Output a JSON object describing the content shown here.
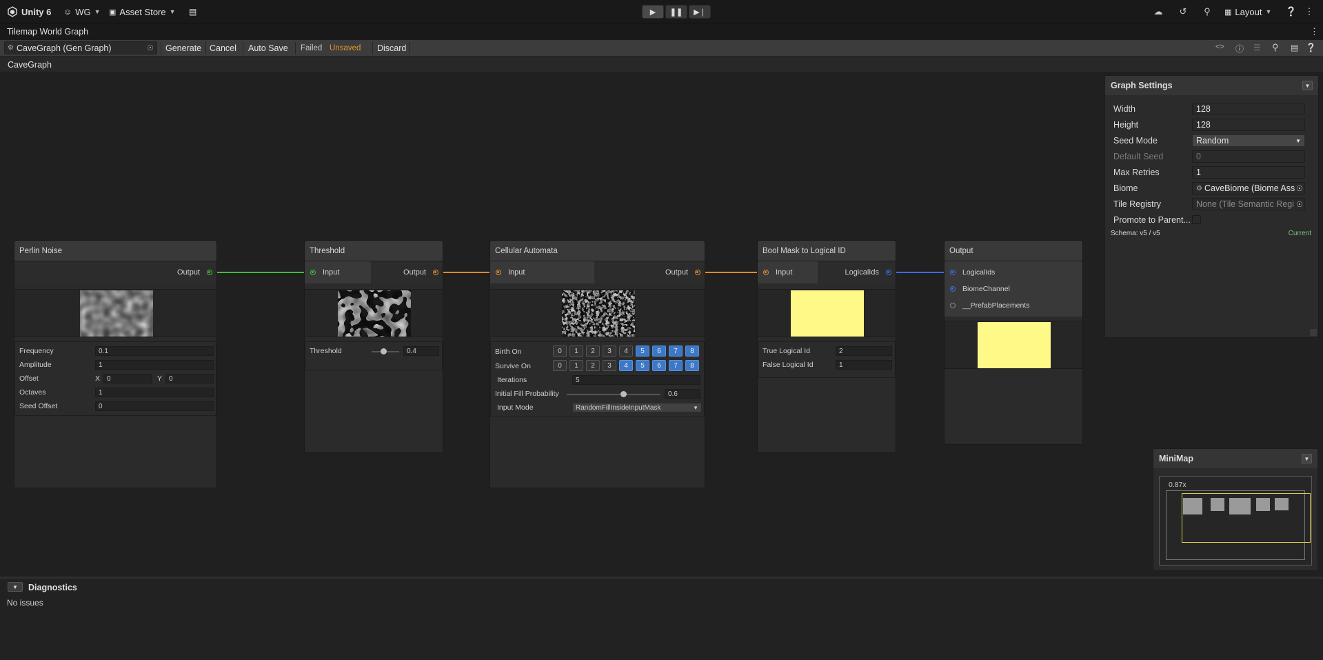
{
  "appbar": {
    "product": "Unity 6",
    "account": "WG",
    "asset_store": "Asset Store",
    "layout": "Layout"
  },
  "window": {
    "title": "Tilemap World Graph"
  },
  "toolbar": {
    "graph_field": "CaveGraph (Gen Graph)",
    "generate": "Generate",
    "cancel": "Cancel",
    "auto_save": "Auto Save",
    "failed": "Failed",
    "unsaved": "Unsaved",
    "discard": "Discard"
  },
  "breadcrumb": "CaveGraph",
  "nodes": {
    "perlin": {
      "title": "Perlin Noise",
      "output": "Output",
      "props": {
        "frequency_label": "Frequency",
        "frequency": "0.1",
        "amplitude_label": "Amplitude",
        "amplitude": "1",
        "offset_label": "Offset",
        "offset_x_label": "X",
        "offset_x": "0",
        "offset_y_label": "Y",
        "offset_y": "0",
        "octaves_label": "Octaves",
        "octaves": "1",
        "seed_offset_label": "Seed Offset",
        "seed_offset": "0"
      }
    },
    "threshold": {
      "title": "Threshold",
      "input": "Input",
      "output": "Output",
      "threshold_label": "Threshold",
      "threshold_value": "0.4"
    },
    "cellular": {
      "title": "Cellular Automata",
      "input": "Input",
      "output": "Output",
      "birth_label": "Birth On",
      "survive_label": "Survive On",
      "digits": [
        "0",
        "1",
        "2",
        "3",
        "4",
        "5",
        "6",
        "7",
        "8"
      ],
      "birth_on": [
        5,
        6,
        7,
        8
      ],
      "survive_on": [
        4,
        5,
        6,
        7,
        8
      ],
      "iterations_label": "Iterations",
      "iterations": "5",
      "fill_label": "Initial Fill Probability",
      "fill_value": "0.6",
      "input_mode_label": "Input Mode",
      "input_mode": "RandomFillInsideInputMask"
    },
    "boolmask": {
      "title": "Bool Mask to Logical ID",
      "input": "Input",
      "output": "LogicalIds",
      "true_label": "True Logical Id",
      "true_value": "2",
      "false_label": "False Logical Id",
      "false_value": "1"
    },
    "output": {
      "title": "Output",
      "port1": "LogicalIds",
      "port2": "BiomeChannel",
      "port3": "__PrefabPlacements"
    }
  },
  "graph_settings": {
    "title": "Graph Settings",
    "width_label": "Width",
    "width": "128",
    "height_label": "Height",
    "height": "128",
    "seed_mode_label": "Seed Mode",
    "seed_mode": "Random",
    "default_seed_label": "Default Seed",
    "default_seed": "0",
    "max_retries_label": "Max Retries",
    "max_retries": "1",
    "biome_label": "Biome",
    "biome": "CaveBiome (Biome Ass",
    "tile_registry_label": "Tile Registry",
    "tile_registry": "None (Tile Semantic Regi",
    "promote_label": "Promote to Parent...",
    "schema": "Schema: v5 / v5",
    "schema_status": "Current"
  },
  "minimap": {
    "title": "MiniMap",
    "zoom": "0.87x"
  },
  "diagnostics": {
    "title": "Diagnostics",
    "message": "No issues"
  },
  "colors": {
    "edge_bool": "#3cbe3c",
    "edge_float": "#e08a2a",
    "edge_logical": "#3a6de0",
    "unsaved": "#e09a2a",
    "current": "#7ec27e",
    "selected_digit": "#3b78c8"
  }
}
